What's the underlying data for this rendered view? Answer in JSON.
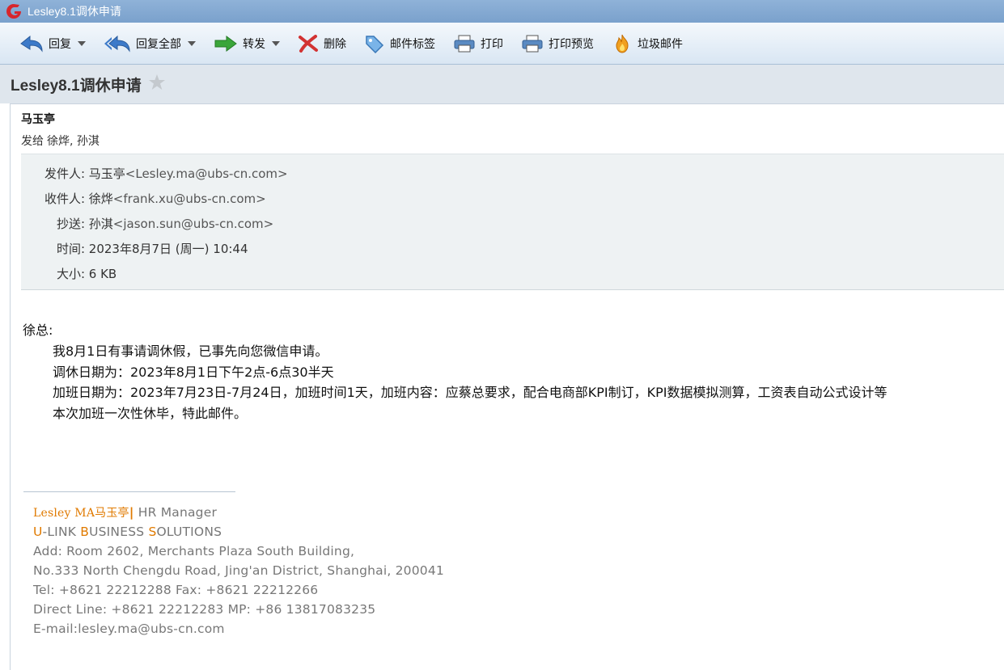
{
  "window": {
    "title": "Lesley8.1调休申请"
  },
  "toolbar": {
    "reply": "回复",
    "reply_all": "回复全部",
    "forward": "转发",
    "delete": "删除",
    "mail_tag": "邮件标签",
    "print": "打印",
    "print_preview": "打印预览",
    "junk": "垃圾邮件"
  },
  "mail": {
    "subject": "Lesley8.1调休申请",
    "sender_display": "马玉亭",
    "sent_to_label": "发给",
    "sent_to": "徐烨, 孙淇",
    "meta": {
      "from_label": "发件人:",
      "from_name": "马玉亭",
      "from_email": "<Lesley.ma@ubs-cn.com>",
      "to_label": "收件人:",
      "to_name": "徐烨",
      "to_email": "<frank.xu@ubs-cn.com>",
      "cc_label": "抄送:",
      "cc_name": "孙淇",
      "cc_email": "<jason.sun@ubs-cn.com>",
      "time_label": "时间:",
      "time": "2023年8月7日 (周一) 10:44",
      "size_label": "大小:",
      "size": "6 KB"
    },
    "body": {
      "greeting": "徐总:",
      "line1": "我8月1日有事请调休假，已事先向您微信申请。",
      "line2": "调休日期为：2023年8月1日下午2点-6点30半天",
      "line3": "加班日期为：2023年7月23日-7月24日，加班时间1天，加班内容：应蔡总要求，配合电商部KPI制订，KPI数据模拟测算，工资表自动公式设计等",
      "line4": "本次加班一次性休毕，特此邮件。"
    },
    "signature": {
      "name": "Lesley MA马玉亭",
      "bar": "|",
      "title": " HR Manager",
      "company_u": "U",
      "company_link": "-LINK ",
      "company_b": "B",
      "company_usiness": "USINESS ",
      "company_s": "S",
      "company_olutions": "OLUTIONS",
      "address1": "Add: Room 2602, Merchants Plaza South Building,",
      "address2": "No.333 North Chengdu Road, Jing'an District, Shanghai, 200041",
      "tel": "Tel: +8621 22212288  Fax: +8621 22212266",
      "direct": "Direct Line: +8621 22212283   MP: +86 13817083235",
      "email": "E-mail:lesley.ma@ubs-cn.com"
    }
  },
  "colors": {
    "accent": "#e07a00",
    "titlebar": "#7aa1cc"
  }
}
